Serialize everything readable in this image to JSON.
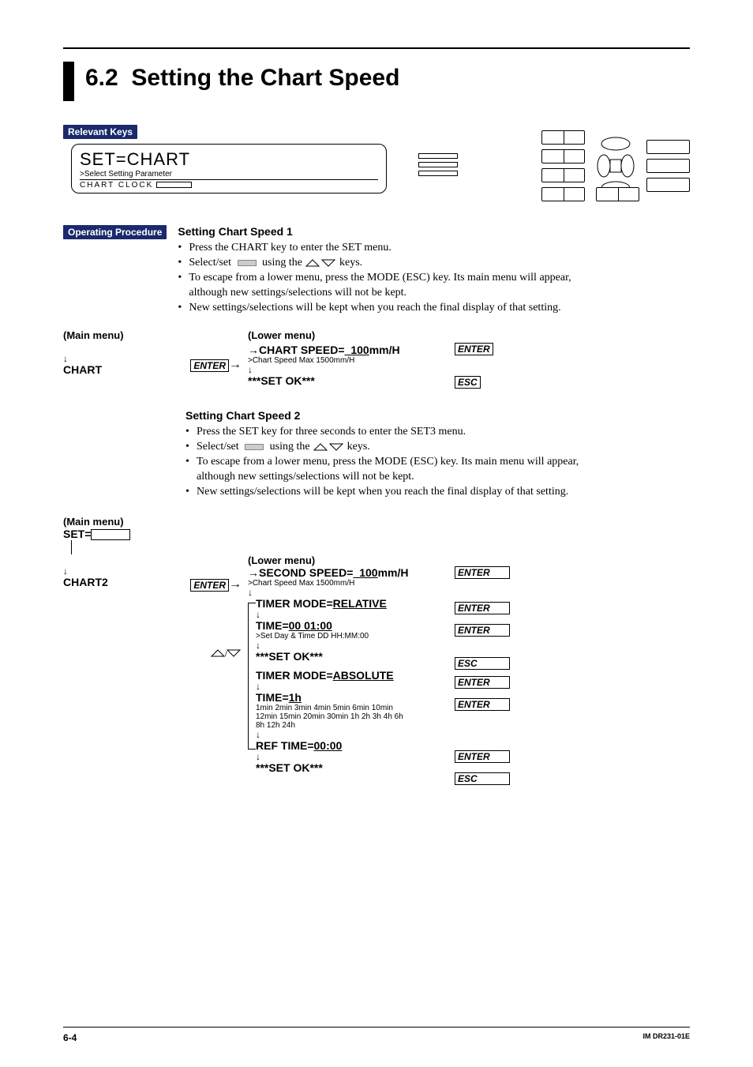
{
  "header": {
    "section_number": "6.2",
    "section_title": "Setting the Chart Speed"
  },
  "labels": {
    "relevant_keys": "Relevant Keys",
    "operating_procedure": "Operating Procedure"
  },
  "lcd": {
    "title": "SET=CHART",
    "sub1": ">Select Setting Parameter",
    "sub2": "CHART  CLOCK"
  },
  "proc1": {
    "heading": "Setting Chart Speed 1",
    "b1": "Press the CHART key to enter the SET menu.",
    "b2a": "Select/set ",
    "b2b": " using the ",
    "b2c": " keys.",
    "b3a": "To escape from a lower menu, press the MODE (ESC) key. Its main menu will appear,",
    "b3b": "although new settings/selections will not be kept.",
    "b4": "New settings/selections will be kept when you reach the final display of that setting."
  },
  "flow1": {
    "main_label": "(Main menu)",
    "main_item": "CHART",
    "enter": "ENTER",
    "lower_label": "(Lower menu)",
    "line1_pre": "CHART SPEED=",
    "line1_val": "_100",
    "line1_suf": "mm/H",
    "line1_sub": ">Chart Speed Max 1500mm/H",
    "setok": "***SET OK***",
    "esc": "ESC"
  },
  "proc2": {
    "heading": "Setting Chart Speed 2",
    "b1": "Press the SET key for three seconds to enter the SET3 menu.",
    "b2a": "Select/set ",
    "b2b": " using the ",
    "b2c": " keys.",
    "b3a": "To escape from a lower menu, press the MODE (ESC) key. Its main menu will appear,",
    "b3b": "although new settings/selections will not be kept.",
    "b4": "New settings/selections will be kept when you reach the final display of that setting."
  },
  "flow2": {
    "main_label": "(Main menu)",
    "set_eq": "SET=",
    "main_item": "CHART2",
    "enter": "ENTER",
    "lower_label": "(Lower menu)",
    "l1_pre": "SECOND SPEED=",
    "l1_val": "_100",
    "l1_suf": "mm/H",
    "l1_sub": ">Chart Speed Max 1500mm/H",
    "tm_rel_pre": "TIMER MODE=",
    "tm_rel_val": "RELATIVE",
    "time_rel_pre": "TIME=",
    "time_rel_val": "00 01:00",
    "time_rel_sub": ">Set Day & Time DD HH:MM:00",
    "setok": "***SET OK***",
    "tm_abs_pre": "TIMER MODE=",
    "tm_abs_val": "ABSOLUTE",
    "time_abs_pre": "TIME=",
    "time_abs_val": "1h",
    "time_abs_sub1": "1min 2min 3min 4min 5min 6min 10min",
    "time_abs_sub2": "12min 15min 20min 30min 1h 2h 3h 4h 6h",
    "time_abs_sub3": "8h 12h 24h",
    "ref_pre": "REF TIME=",
    "ref_val": "00:00",
    "esc": "ESC"
  },
  "footer": {
    "page": "6-4",
    "docid": "IM DR231-01E"
  }
}
